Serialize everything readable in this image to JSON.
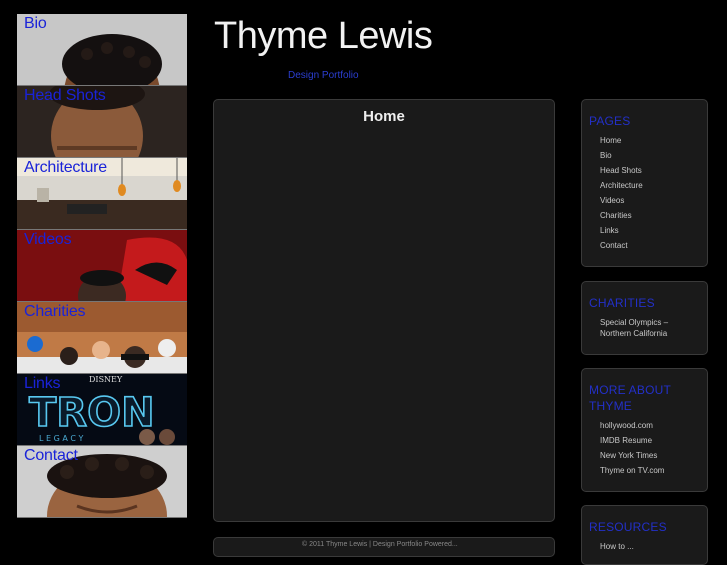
{
  "header": {
    "site_title": "Thyme Lewis",
    "tagline": "Design Portfolio"
  },
  "left_nav": [
    {
      "label": "Bio",
      "image": "portrait-top-of-head"
    },
    {
      "label": "Head Shots",
      "image": "portrait-forehead"
    },
    {
      "label": "Architecture",
      "image": "interior-with-pendant-lights"
    },
    {
      "label": "Videos",
      "image": "red-helmet-person"
    },
    {
      "label": "Charities",
      "image": "group-on-snow"
    },
    {
      "label": "Links",
      "image": "tron-legacy-logo"
    },
    {
      "label": "Contact",
      "image": "portrait-smiling"
    }
  ],
  "left_nav_extra": {
    "disney_text": "DISNEY",
    "tron_text": "TRON",
    "legacy_text": "L E G A C Y"
  },
  "main": {
    "heading": "Home",
    "footer_text": "© 2011 Thyme Lewis | Design Portfolio Powered..."
  },
  "sidebar": {
    "pages": {
      "title": "PAGES",
      "items": [
        "Home",
        "Bio",
        "Head Shots",
        "Architecture",
        "Videos",
        "Charities",
        "Links",
        "Contact"
      ]
    },
    "charities": {
      "title": "CHARITIES",
      "items": [
        "Special Olympics – Northern California"
      ]
    },
    "more": {
      "title": "MORE ABOUT THYME",
      "items": [
        "hollywood.com",
        "IMDB Resume",
        "New York Times",
        "Thyme on TV.com"
      ]
    },
    "resources": {
      "title": "RESOURCES",
      "items": [
        "How to ..."
      ]
    }
  },
  "colors": {
    "background": "#000000",
    "link_blue": "#1a23d8",
    "panel": "#1a1a1a"
  }
}
